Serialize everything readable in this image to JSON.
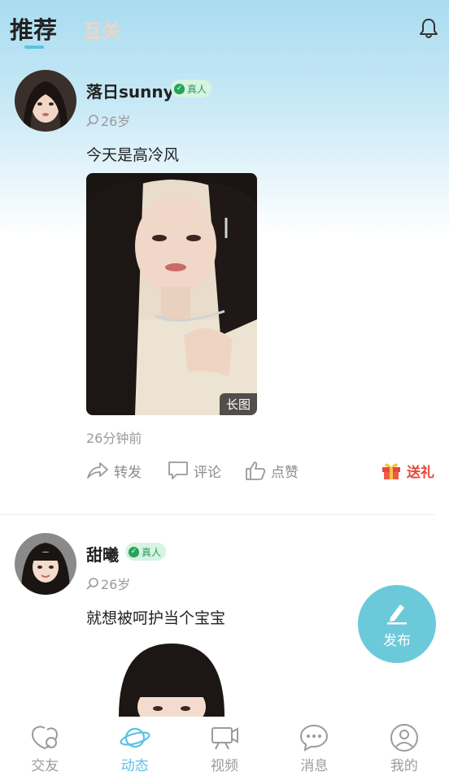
{
  "header": {
    "tabs": [
      {
        "label": "推荐",
        "active": true
      },
      {
        "label": "互关",
        "active": false
      }
    ],
    "icons": {
      "notification": "bell-icon"
    }
  },
  "posts": [
    {
      "username": "落日sunny",
      "verified_label": "真人",
      "age": "26岁",
      "text": "今天是高冷风",
      "photo_tag": "长图",
      "time_ago": "26分钟前",
      "actions": {
        "share": "转发",
        "comment": "评论",
        "like": "点赞",
        "gift": "送礼"
      }
    },
    {
      "username": "甜曦",
      "verified_label": "真人",
      "age": "26岁",
      "text": "就想被呵护当个宝宝"
    }
  ],
  "fab": {
    "label": "发布"
  },
  "nav": {
    "items": [
      {
        "label": "交友",
        "icon": "heart-chat-icon",
        "active": false
      },
      {
        "label": "动态",
        "icon": "planet-icon",
        "active": true
      },
      {
        "label": "视频",
        "icon": "video-icon",
        "active": false
      },
      {
        "label": "消息",
        "icon": "message-icon",
        "active": false
      },
      {
        "label": "我的",
        "icon": "profile-icon",
        "active": false
      }
    ]
  },
  "colors": {
    "accent": "#5cc1df",
    "fab": "#6cc9d9",
    "gift": "#e6483b",
    "verified": "#28a35b"
  }
}
